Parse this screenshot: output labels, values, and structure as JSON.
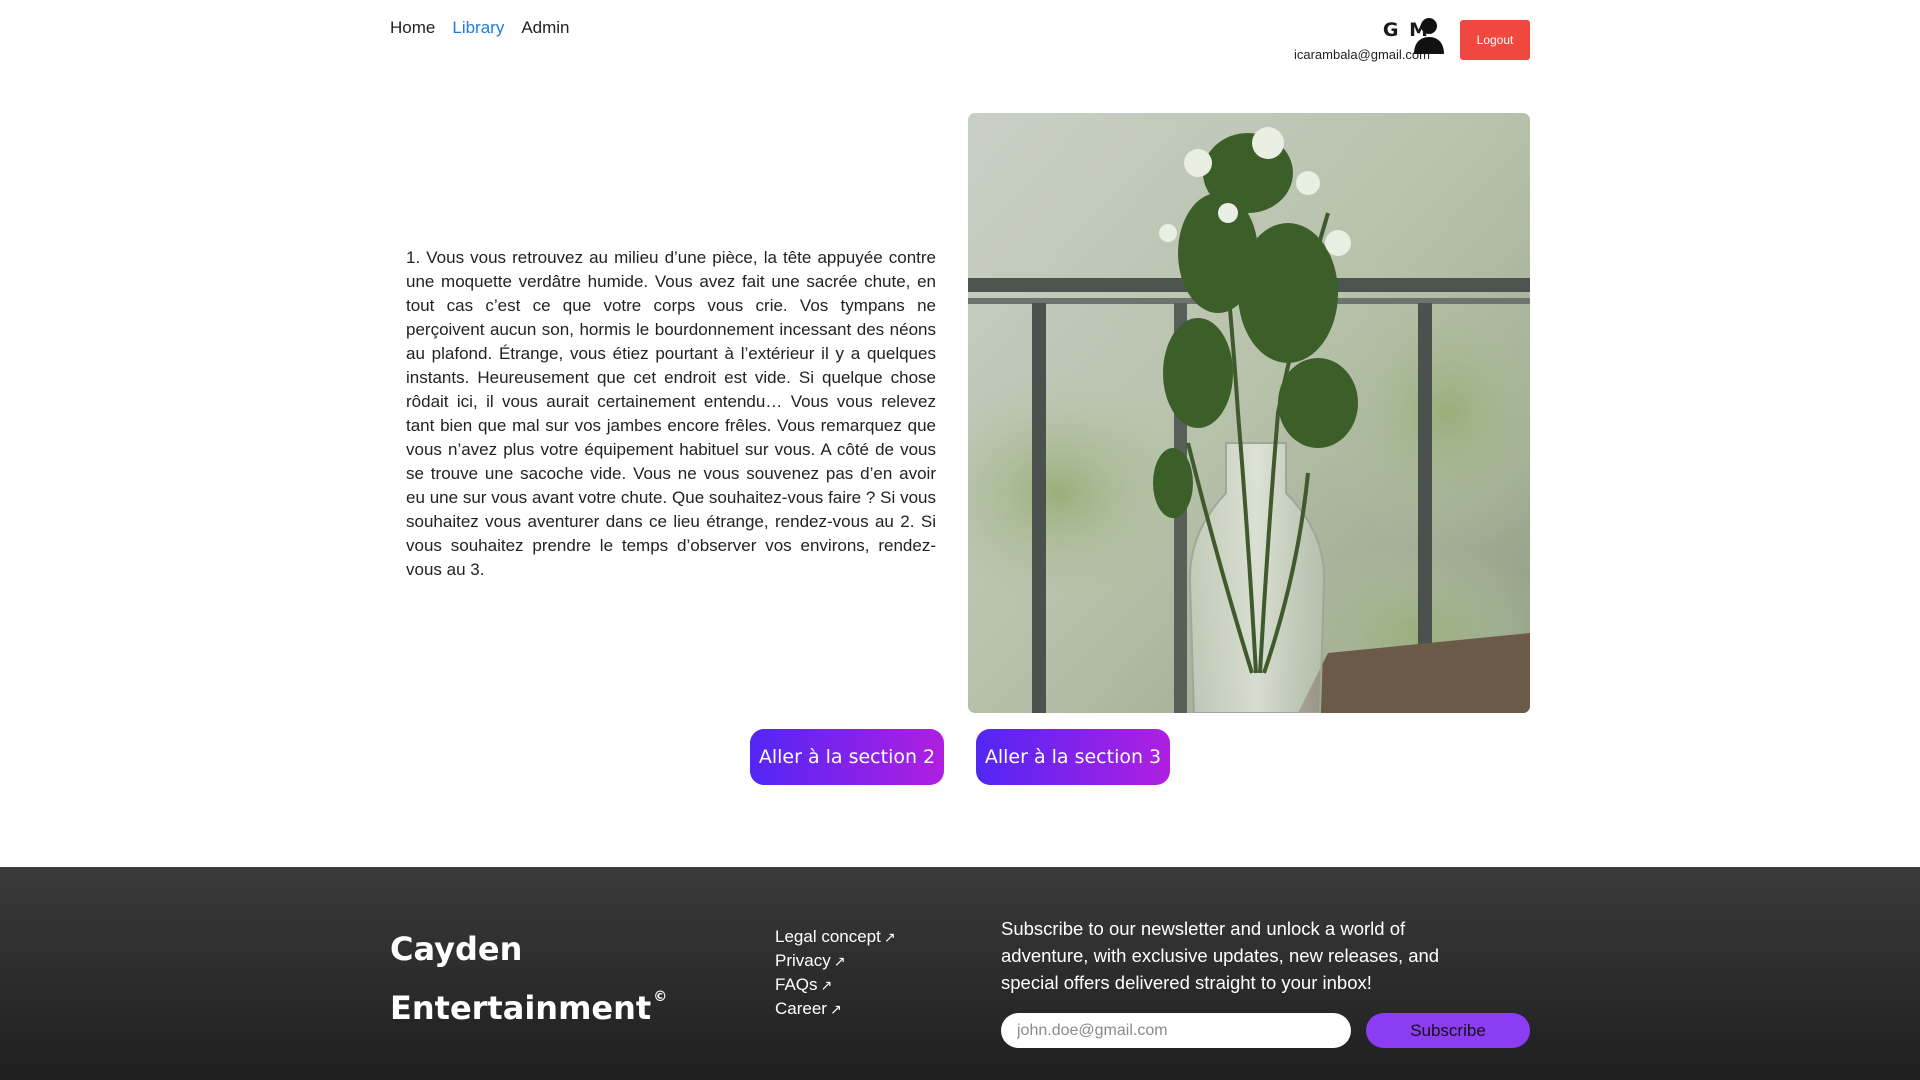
{
  "nav": {
    "items": [
      {
        "label": "Home",
        "active": false
      },
      {
        "label": "Library",
        "active": true
      },
      {
        "label": "Admin",
        "active": false
      }
    ]
  },
  "user": {
    "initials": "G M",
    "email": "icarambala@gmail.com",
    "avatar_icon": "user-icon",
    "logout_label": "Logout"
  },
  "story": {
    "text": "1. Vous vous retrouvez au milieu d’une pièce, la tête appuyée contre une moquette verdâtre humide. Vous avez fait une sacrée chute, en tout cas c’est ce que votre corps vous crie. Vos tympans ne perçoivent aucun son, hormis le bourdonnement incessant des néons au plafond. Étrange, vous étiez pourtant à l’extérieur il y a quelques instants. Heureusement que cet endroit est vide. Si quelque chose rôdait ici, il vous aurait certainement entendu… Vous vous relevez tant bien que mal sur vos jambes encore frêles. Vous remarquez que vous n’avez plus votre équipement habituel sur vous. A côté de vous se trouve une sacoche vide. Vous ne vous souvenez pas d’en avoir eu une sur vous avant votre chute. Que souhaitez-vous faire ? Si vous souhaitez vous aventurer dans ce lieu étrange, rendez-vous au 2. Si vous souhaitez prendre le temps d’observer vos environs, rendez-vous au 3.",
    "image": "vase-of-flowers-on-balcony",
    "choices": [
      {
        "label": "Aller à la section 2"
      },
      {
        "label": "Aller à la section 3"
      }
    ]
  },
  "footer": {
    "brand_line1": "Cayden",
    "brand_line2": "Entertainment",
    "brand_mark": "©",
    "links": [
      {
        "label": "Legal concept",
        "icon": "external-arrow-icon"
      },
      {
        "label": "Privacy",
        "icon": "external-arrow-icon"
      },
      {
        "label": "FAQs",
        "icon": "external-arrow-icon"
      },
      {
        "label": "Career",
        "icon": "external-arrow-icon"
      }
    ],
    "newsletter_text": "Subscribe to our newsletter and unlock a world of adventure, with exclusive updates, new releases, and special offers delivered straight to your inbox!",
    "email_placeholder": "john.doe@gmail.com",
    "subscribe_label": "Subscribe"
  },
  "colors": {
    "active_link": "#1e7ce6",
    "logout": "#f0483e",
    "button_gradient_start": "#5226f5",
    "button_gradient_end": "#b01fe0",
    "subscribe": "#8c3cf2",
    "footer_bg": "#2b2b2b"
  }
}
